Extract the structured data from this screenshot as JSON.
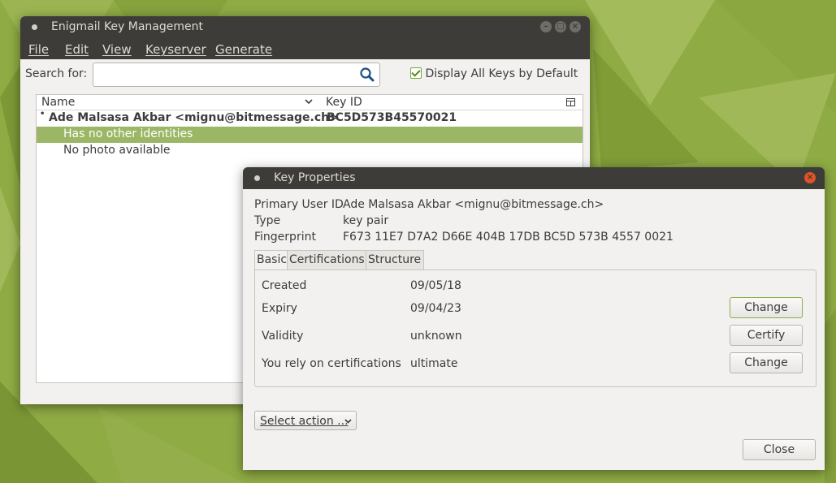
{
  "colors": {
    "accent": "#9bb765",
    "titlebar": "#3d3c38"
  },
  "key_manager": {
    "title": "Enigmail Key Management",
    "menu": [
      "File",
      "Edit",
      "View",
      "Keyserver",
      "Generate"
    ],
    "search_label": "Search for:",
    "search_value": "",
    "display_all_label": "Display All Keys by Default",
    "display_all_checked": true,
    "columns": {
      "name": "Name",
      "keyid": "Key ID"
    },
    "rows": [
      {
        "name": "Ade Malsasa Akbar <mignu@bitmessage.ch>",
        "keyid": "BC5D573B45570021"
      },
      {
        "name": "Has no other identities",
        "keyid": ""
      },
      {
        "name": "No photo available",
        "keyid": ""
      }
    ]
  },
  "key_properties": {
    "title": "Key Properties",
    "primary_uid_label": "Primary User ID",
    "primary_uid": "Ade Malsasa Akbar <mignu@bitmessage.ch>",
    "type_label": "Type",
    "type": "key pair",
    "fingerprint_label": "Fingerprint",
    "fingerprint": "F673 11E7 D7A2 D66E 404B 17DB BC5D 573B 4557 0021",
    "tabs": [
      "Basic",
      "Certifications",
      "Structure"
    ],
    "basic": {
      "created_label": "Created",
      "created": "09/05/18",
      "expiry_label": "Expiry",
      "expiry": "09/04/23",
      "validity_label": "Validity",
      "validity": "unknown",
      "rely_label": "You rely on certifications",
      "rely": "ultimate",
      "change_expiry": "Change",
      "certify": "Certify",
      "change_trust": "Change"
    },
    "select_action": "Select action ...",
    "close": "Close"
  }
}
